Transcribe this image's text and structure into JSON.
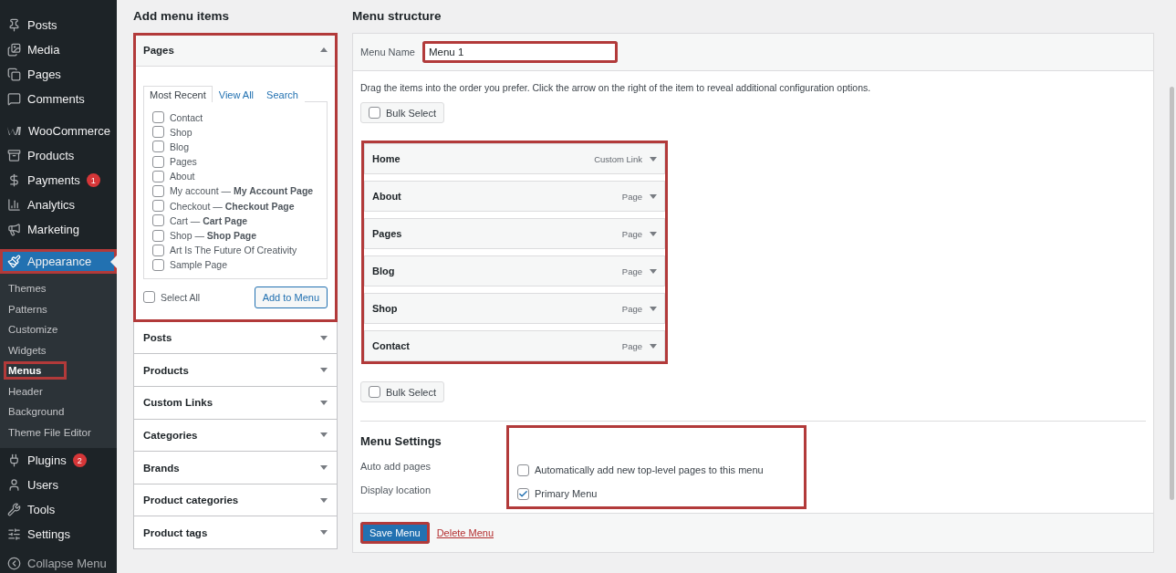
{
  "sidebar": {
    "groups": [
      [
        {
          "label": "Posts",
          "selected": false,
          "highlighted": false
        },
        {
          "label": "Media",
          "selected": false,
          "highlighted": false
        },
        {
          "label": "Pages",
          "selected": false,
          "highlighted": false
        },
        {
          "label": "Comments",
          "selected": false,
          "highlighted": false
        }
      ],
      [
        {
          "label": "WooCommerce",
          "selected": false,
          "highlighted": false
        },
        {
          "label": "Products",
          "selected": false,
          "highlighted": false
        },
        {
          "label": "Payments",
          "badge": "1",
          "selected": false,
          "highlighted": false
        },
        {
          "label": "Analytics",
          "selected": false,
          "highlighted": false
        },
        {
          "label": "Marketing",
          "selected": false,
          "highlighted": false
        }
      ],
      [
        {
          "label": "Appearance",
          "selected": true,
          "highlighted": true,
          "children": [
            {
              "label": "Themes",
              "selected": false,
              "highlighted": false
            },
            {
              "label": "Patterns",
              "selected": false,
              "highlighted": false
            },
            {
              "label": "Customize",
              "selected": false,
              "highlighted": false
            },
            {
              "label": "Widgets",
              "selected": false,
              "highlighted": false
            },
            {
              "label": "Menus",
              "selected": true,
              "highlighted": true
            },
            {
              "label": "Header",
              "selected": false,
              "highlighted": false
            },
            {
              "label": "Background",
              "selected": false,
              "highlighted": false
            },
            {
              "label": "Theme File Editor",
              "selected": false,
              "highlighted": false
            }
          ]
        },
        {
          "label": "Plugins",
          "badge": "2",
          "selected": false,
          "highlighted": false
        },
        {
          "label": "Users",
          "selected": false,
          "highlighted": false
        },
        {
          "label": "Tools",
          "selected": false,
          "highlighted": false
        },
        {
          "label": "Settings",
          "selected": false,
          "highlighted": false
        }
      ]
    ],
    "collapse": "Collapse Menu"
  },
  "add_items": {
    "title": "Add menu items",
    "sections": [
      {
        "title": "Pages",
        "expanded": true,
        "highlighted": true,
        "tabs": [
          {
            "label": "Most Recent",
            "selected": true
          },
          {
            "label": "View All",
            "selected": false
          },
          {
            "label": "Search",
            "selected": false
          }
        ],
        "items": [
          {
            "label": "Contact",
            "checked": false
          },
          {
            "label": "Shop",
            "checked": false
          },
          {
            "label": "Blog",
            "checked": false
          },
          {
            "label": "Pages",
            "checked": false
          },
          {
            "label": "About",
            "checked": false
          },
          {
            "label": "My account — **My Account Page**",
            "checked": false
          },
          {
            "label": "Checkout — **Checkout Page**",
            "checked": false
          },
          {
            "label": "Cart — **Cart Page**",
            "checked": false
          },
          {
            "label": "Shop — **Shop Page**",
            "checked": false
          },
          {
            "label": "Art Is The Future Of Creativity",
            "checked": false
          },
          {
            "label": "Sample Page",
            "checked": false
          }
        ],
        "select_all": {
          "label": "Select All",
          "checked": false
        },
        "button": "Add to Menu"
      },
      {
        "title": "Posts",
        "expanded": false,
        "highlighted": false
      },
      {
        "title": "Products",
        "expanded": false,
        "highlighted": false
      },
      {
        "title": "Custom Links",
        "expanded": false,
        "highlighted": false
      },
      {
        "title": "Categories",
        "expanded": false,
        "highlighted": false
      },
      {
        "title": "Brands",
        "expanded": false,
        "highlighted": false
      },
      {
        "title": "Product categories",
        "expanded": false,
        "highlighted": false
      },
      {
        "title": "Product tags",
        "expanded": false,
        "highlighted": false
      }
    ]
  },
  "structure": {
    "title": "Menu structure",
    "menu_name": {
      "label": "Menu Name",
      "value": "Menu 1",
      "highlighted": true
    },
    "instructions": "Drag the items into the order you prefer. Click the arrow on the right of the item to reveal additional configuration options.",
    "bulk_select": [
      {
        "label": "Bulk Select",
        "checked": false
      },
      {
        "label": "Bulk Select",
        "checked": false
      }
    ],
    "items_highlighted": true,
    "items": [
      {
        "title": "Home",
        "type": "Custom Link"
      },
      {
        "title": "About",
        "type": "Page"
      },
      {
        "title": "Pages",
        "type": "Page"
      },
      {
        "title": "Blog",
        "type": "Page"
      },
      {
        "title": "Shop",
        "type": "Page"
      },
      {
        "title": "Contact",
        "type": "Page"
      }
    ],
    "settings": {
      "title": "Menu Settings",
      "highlighted": true,
      "rows": [
        {
          "label": "Auto add pages",
          "option": "Automatically add new top-level pages to this menu",
          "checked": false
        },
        {
          "label": "Display location",
          "option": "Primary Menu",
          "checked": true
        }
      ]
    },
    "save": {
      "label": "Save Menu",
      "highlighted": true
    },
    "delete": "Delete Menu"
  }
}
